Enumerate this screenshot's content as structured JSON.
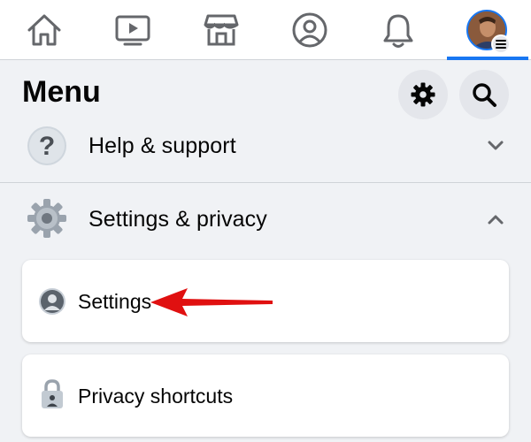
{
  "topnav": {
    "items": [
      {
        "icon": "home-icon"
      },
      {
        "icon": "video-icon"
      },
      {
        "icon": "marketplace-icon"
      },
      {
        "icon": "profile-icon"
      },
      {
        "icon": "notifications-icon"
      },
      {
        "icon": "menu-avatar-icon",
        "active": true
      }
    ],
    "accent_color": "#1877f2"
  },
  "menu": {
    "title": "Menu",
    "settings_button_icon": "gear-icon",
    "search_button_icon": "search-icon"
  },
  "sections": {
    "help": {
      "label": "Help & support",
      "icon": "question-icon",
      "expanded": false
    },
    "settings_privacy": {
      "label": "Settings & privacy",
      "icon": "gear-icon",
      "expanded": true
    }
  },
  "cards": {
    "settings": {
      "label": "Settings",
      "icon": "user-circle-icon"
    },
    "privacy_shortcuts": {
      "label": "Privacy shortcuts",
      "icon": "lock-icon"
    }
  },
  "annotation": {
    "arrow_color": "#e01010"
  }
}
